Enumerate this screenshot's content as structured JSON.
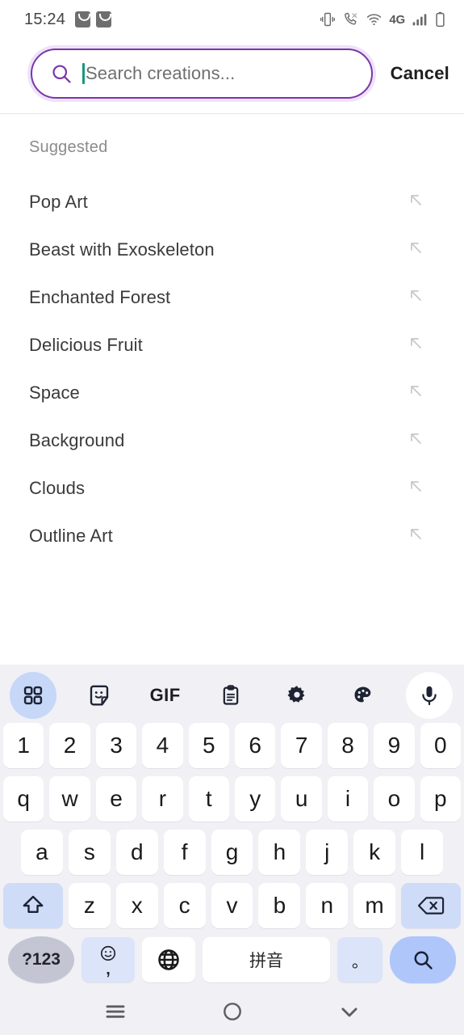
{
  "status_bar": {
    "time": "15:24",
    "left_icons": [
      "shopping-bag-notification",
      "shopping-bag-notification"
    ],
    "network_label": "4G",
    "right_icons": [
      "vibrate-icon",
      "call-icon",
      "wifi-icon",
      "signal-icon",
      "battery-icon"
    ]
  },
  "search": {
    "placeholder": "Search creations...",
    "value": "",
    "cancel_label": "Cancel",
    "border_color": "#7B36A8",
    "icon_color": "#7B36A8",
    "caret_color": "#14997C"
  },
  "suggestions": {
    "header": "Suggested",
    "items": [
      {
        "label": "Pop Art",
        "action_icon": "arrow-up-left-icon"
      },
      {
        "label": "Beast with Exoskeleton",
        "action_icon": "arrow-up-left-icon"
      },
      {
        "label": "Enchanted Forest",
        "action_icon": "arrow-up-left-icon"
      },
      {
        "label": "Delicious Fruit",
        "action_icon": "arrow-up-left-icon"
      },
      {
        "label": "Space",
        "action_icon": "arrow-up-left-icon"
      },
      {
        "label": "Background",
        "action_icon": "arrow-up-left-icon"
      },
      {
        "label": "Clouds",
        "action_icon": "arrow-up-left-icon"
      },
      {
        "label": "Outline Art",
        "action_icon": "arrow-up-left-icon"
      }
    ]
  },
  "keyboard": {
    "toolbar": [
      {
        "name": "grid-icon",
        "label": "",
        "active": true
      },
      {
        "name": "sticker-icon",
        "label": ""
      },
      {
        "name": "gif-icon",
        "label": "GIF"
      },
      {
        "name": "clipboard-icon",
        "label": ""
      },
      {
        "name": "gear-icon",
        "label": ""
      },
      {
        "name": "palette-icon",
        "label": ""
      },
      {
        "name": "microphone-icon",
        "label": ""
      }
    ],
    "row_numbers": [
      "1",
      "2",
      "3",
      "4",
      "5",
      "6",
      "7",
      "8",
      "9",
      "0"
    ],
    "row_top": [
      "q",
      "w",
      "e",
      "r",
      "t",
      "y",
      "u",
      "i",
      "o",
      "p"
    ],
    "row_home": [
      "a",
      "s",
      "d",
      "f",
      "g",
      "h",
      "j",
      "k",
      "l"
    ],
    "row_bottom": [
      "z",
      "x",
      "c",
      "v",
      "b",
      "n",
      "m"
    ],
    "shift_icon": "shift-icon",
    "backspace_icon": "backspace-icon",
    "symbols_label": "?123",
    "emoji_icon": "emoji-icon",
    "comma_label": ",",
    "globe_icon": "globe-icon",
    "space_label": "拼音",
    "period_label": "。",
    "enter_icon": "search-icon",
    "key_bg": "#ffffff",
    "mod_key_bg": "#CFDCF8",
    "enter_key_bg": "#AEC6FA",
    "keyboard_bg": "#F0F0F5"
  },
  "nav_bar": {
    "recents_icon": "menu-icon",
    "home_icon": "circle-icon",
    "back_icon": "chevron-down-icon"
  }
}
